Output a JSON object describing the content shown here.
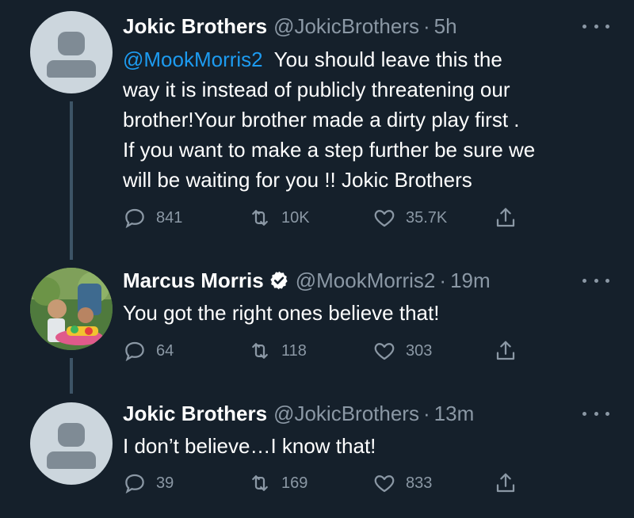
{
  "tweets": [
    {
      "name": "Jokic Brothers",
      "handle": "@JokicBrothers",
      "time": "5h",
      "mention": "@MookMorris2",
      "lines": [
        "  You should leave this the",
        "way it is instead of publicly threatening our",
        "brother!Your brother made a dirty play first .",
        "If you want to make a step further be sure we",
        "will be waiting for you !! Jokic Brothers"
      ],
      "replies": "841",
      "retweets": "10K",
      "likes": "35.7K"
    },
    {
      "name": "Marcus Morris",
      "verified": true,
      "handle": "@MookMorris2",
      "time": "19m",
      "text": "You got the right ones believe that!",
      "replies": "64",
      "retweets": "118",
      "likes": "303"
    },
    {
      "name": "Jokic Brothers",
      "handle": "@JokicBrothers",
      "time": "13m",
      "text": "I don’t believe…I know that!",
      "replies": "39",
      "retweets": "169",
      "likes": "833"
    }
  ],
  "colors": {
    "background": "#15202b",
    "link": "#1d9bf0",
    "secondary": "#8b98a5",
    "connector": "#3d5466"
  },
  "icons": [
    "reply-icon",
    "retweet-icon",
    "like-icon",
    "share-icon",
    "more-icon",
    "verified-badge-icon",
    "default-avatar-icon"
  ],
  "separator": "·"
}
